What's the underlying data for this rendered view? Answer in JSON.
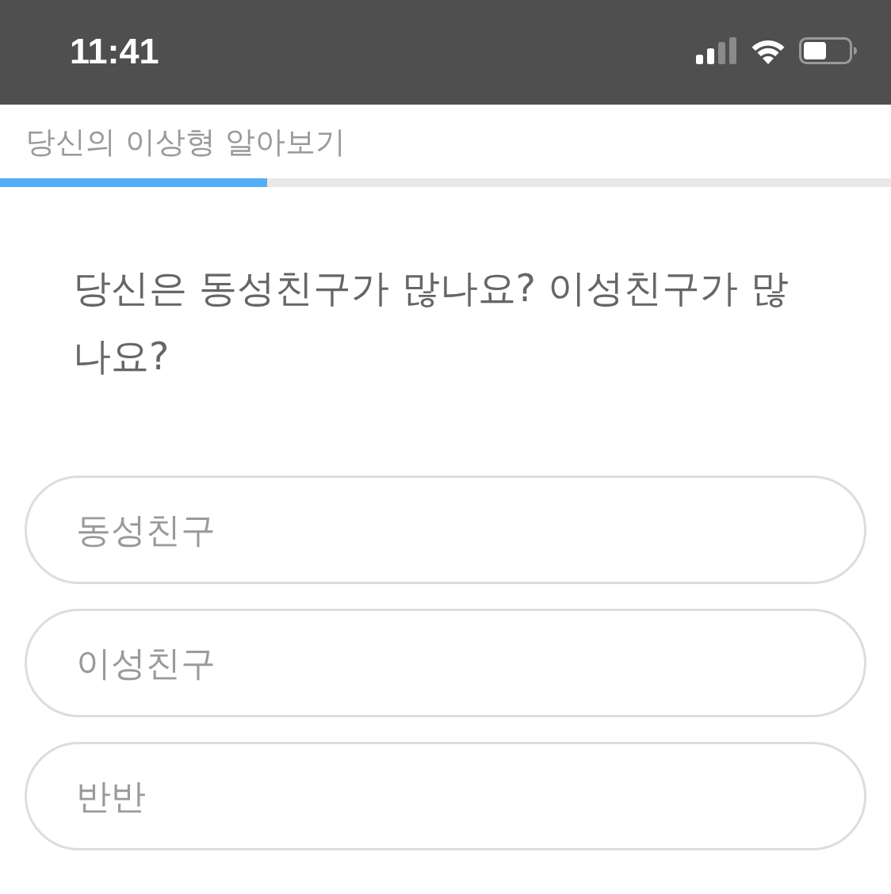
{
  "status_bar": {
    "time": "11:41"
  },
  "header": {
    "title": "당신의 이상형 알아보기"
  },
  "progress": {
    "level": 0.3
  },
  "question": {
    "text": "당신은 동성친구가 많나요? 이성친구가 많나요?"
  },
  "options": [
    {
      "label": "동성친구",
      "selected": false
    },
    {
      "label": "이성친구",
      "selected": false
    },
    {
      "label": "반반",
      "selected": false
    }
  ]
}
